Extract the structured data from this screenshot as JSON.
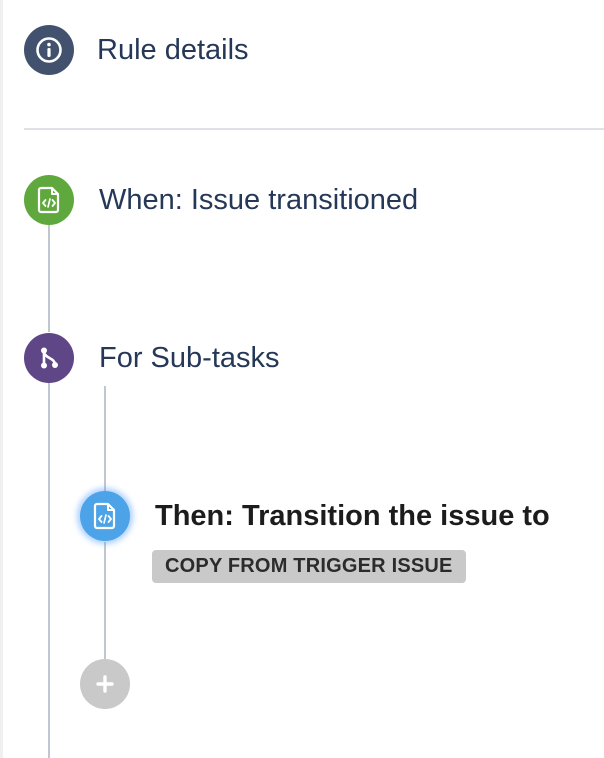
{
  "rule_details": {
    "label": "Rule details",
    "icon": "info-icon",
    "color": "#42526e"
  },
  "trigger": {
    "label": "When: Issue transitioned",
    "icon": "trigger-doc-icon",
    "color": "#5fa83d"
  },
  "branch": {
    "label": "For Sub-tasks",
    "icon": "branch-icon",
    "color": "#5e4687"
  },
  "action": {
    "label": "Then: Transition the issue to",
    "badge": "COPY FROM TRIGGER ISSUE",
    "icon": "action-doc-icon",
    "color": "#4ca3e8"
  },
  "add_component": {
    "icon": "plus-icon",
    "color": "#c9c9c9"
  }
}
